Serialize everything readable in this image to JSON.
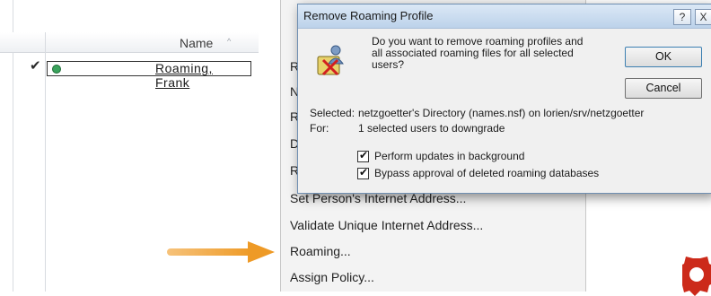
{
  "list": {
    "name_header": "Name",
    "sort_indicator": "^",
    "rows": [
      {
        "checked": true,
        "name": "Roaming, Frank"
      }
    ]
  },
  "menu": {
    "partial_letters": [
      "R",
      "N",
      "R",
      "D",
      "R"
    ],
    "items": [
      "Set Person's Internet Address...",
      "Validate Unique Internet Address...",
      "Roaming...",
      "Assign Policy..."
    ]
  },
  "dialog": {
    "title": "Remove Roaming Profile",
    "help_label": "?",
    "close_label": "X",
    "question_lines": [
      "Do you want to remove roaming profiles and",
      "all associated roaming files for all selected",
      "users?"
    ],
    "ok_label": "OK",
    "cancel_label": "Cancel",
    "selected_label": "Selected:",
    "selected_value": "netzgoetter's Directory (names.nsf) on lorien/srv/netzgoetter",
    "for_label": "For:",
    "for_value": "1 selected users to downgrade",
    "options": [
      {
        "label": "Perform updates in background",
        "checked": true
      },
      {
        "label": "Bypass approval of deleted roaming databases",
        "checked": true
      }
    ]
  },
  "colors": {
    "arrow": "#f0a030",
    "titlebar": "#c8dbef",
    "logo": "#cc2a1a"
  },
  "icons": [
    "check-icon",
    "status-dot-icon",
    "sort-ascending-icon",
    "remove-profile-icon",
    "help-icon",
    "close-icon",
    "arrow-icon",
    "gear-logo-icon"
  ]
}
